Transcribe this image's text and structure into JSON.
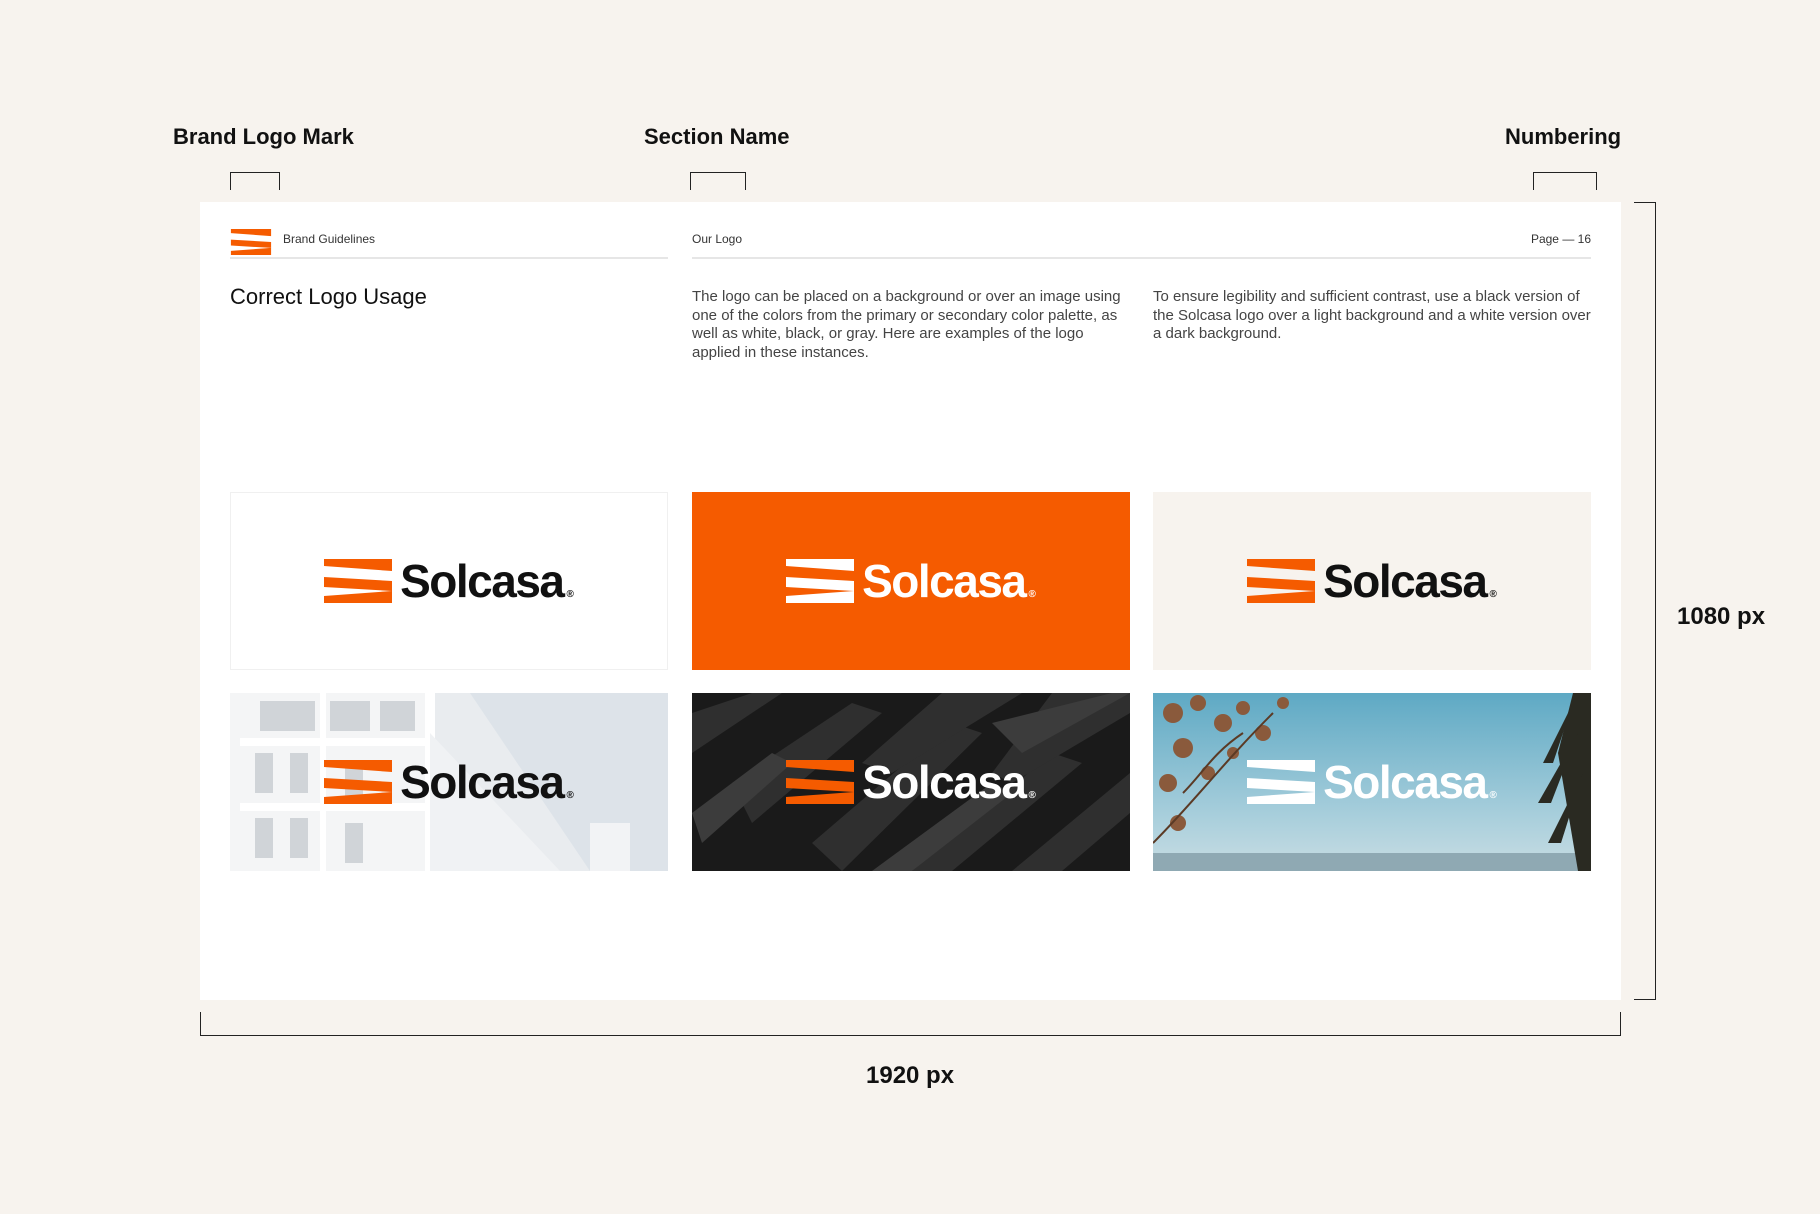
{
  "annotations": {
    "brand_logo_mark": "Brand Logo Mark",
    "section_name": "Section Name",
    "numbering": "Numbering",
    "height": "1080 px",
    "width": "1920 px"
  },
  "header": {
    "brand_guidelines": "Brand Guidelines",
    "section": "Our Logo",
    "page": "Page — 16"
  },
  "content": {
    "title": "Correct Logo Usage",
    "paragraph_1": "The logo can be placed on a background or over an image using one of the colors from the primary or secondary color palette, as well as white, black, or gray. Here are examples of the logo applied in these instances.",
    "paragraph_2": "To ensure legibility and sufficient contrast, use a black version of the Solcasa logo over a light background and a white version over a dark background."
  },
  "logo": {
    "wordmark": "Solcasa",
    "registered": "®"
  },
  "colors": {
    "brand_orange": "#f55b00",
    "cream": "#f7f3ee",
    "dark": "#111111",
    "white": "#ffffff"
  }
}
